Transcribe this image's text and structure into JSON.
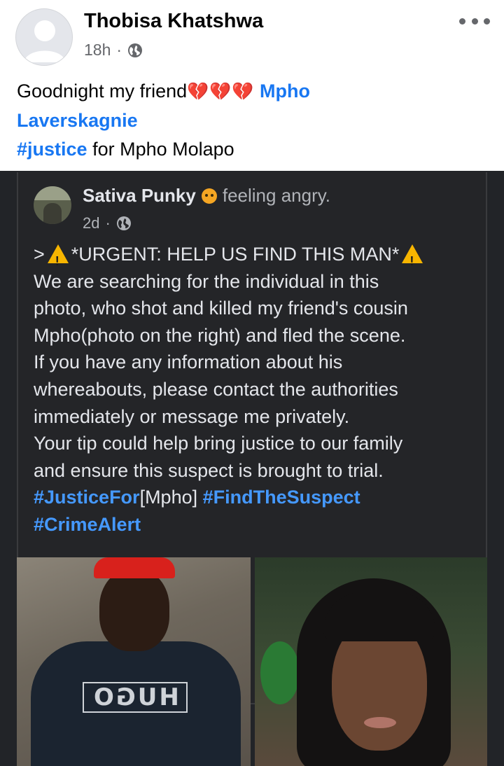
{
  "post": {
    "author": "Thobisa Khatshwa",
    "time": "18h",
    "separator": "·",
    "privacy_icon": "globe-icon",
    "more_icon": "more-horizontal-icon",
    "caption": {
      "text1": "Goodnight my friend",
      "emoji": "💔💔💔",
      "mention_part1": "Mpho",
      "mention_part2": "Laverskagnie",
      "hashtag": "#justice",
      "rest": " for Mpho Molapo"
    }
  },
  "shared_post": {
    "author": "Sativa Punky",
    "feeling": "feeling angry.",
    "feeling_icon": "angry-face-icon",
    "time": "2d",
    "separator": "·",
    "privacy_icon": "globe-icon",
    "lines": {
      "l1_prefix": ">",
      "l1_text": "*URGENT: HELP US FIND THIS MAN*",
      "l2": "We are searching for the individual in this",
      "l3": "photo, who shot and killed my friend's cousin",
      "l4": "Mpho(photo on the right) and fled the scene.",
      "l5": "If you have any information about his",
      "l6": "whereabouts, please contact the authorities",
      "l7": "immediately or message me privately.",
      "l8": "Your tip could help bring justice to our family",
      "l9": "and ensure this suspect is brought to trial."
    },
    "hashtags": {
      "tag1": "#JusticeFor",
      "tag1_suffix": "[Mpho]",
      "tag2": "#FindTheSuspect",
      "tag3": "#CrimeAlert"
    },
    "shirt_text": "HUGO",
    "warning_icon": "warning-icon"
  },
  "colors": {
    "link": "#1877f2",
    "dark_link": "#4599ff",
    "dark_bg": "#242528",
    "warning": "#f7b500"
  }
}
